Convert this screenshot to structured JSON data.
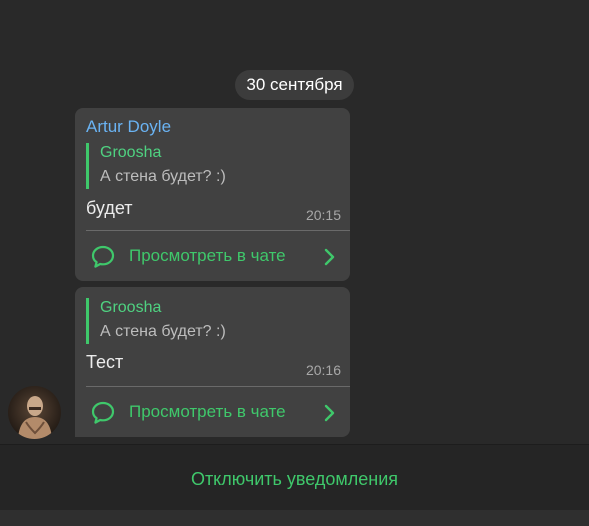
{
  "date_separator": "30 сентября",
  "messages": [
    {
      "sender": "Artur Doyle",
      "reply_author": "Groosha",
      "reply_text": "А стена будет? :)",
      "text": "будет",
      "time": "20:15",
      "action_label": "Просмотреть в чате",
      "action_icon": "chat-bubble-icon",
      "action_chevron": "chevron-right-icon"
    },
    {
      "reply_author": "Groosha",
      "reply_text": "А стена будет? :)",
      "text": "Тест",
      "time": "20:16",
      "action_label": "Просмотреть в чате",
      "action_icon": "chat-bubble-icon",
      "action_chevron": "chevron-right-icon"
    }
  ],
  "footer": {
    "mute_label": "Отключить уведомления"
  },
  "colors": {
    "background": "#292929",
    "bubble": "#414141",
    "accent_green": "#3fc86b",
    "sender_blue": "#6ab3f3",
    "date_pill": "#3c3c3c"
  }
}
